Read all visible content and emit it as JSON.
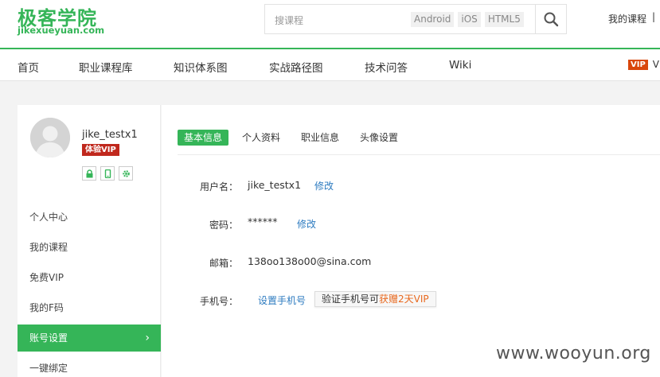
{
  "header": {
    "logo_cn": "极客学院",
    "logo_en": "jikexueyuan.com",
    "search_placeholder": "搜课程",
    "search_tags": [
      "Android",
      "iOS",
      "HTML5"
    ],
    "my_course": "我的课程",
    "separator": "|"
  },
  "nav": {
    "items": [
      "首页",
      "职业课程库",
      "知识体系图",
      "实战路径图",
      "技术问答",
      "Wiki"
    ],
    "vip_badge": "VIP",
    "vip_text": "VI"
  },
  "sidebar": {
    "username": "jike_testx1",
    "vip_label": "体验VIP",
    "bind_icons": [
      "lock-icon",
      "phone-icon",
      "gear-icon"
    ],
    "items": [
      "个人中心",
      "我的课程",
      "免费VIP",
      "我的F码",
      "账号设置",
      "一键绑定"
    ],
    "active_index": 4,
    "chevron": "›"
  },
  "content": {
    "tabs": [
      "基本信息",
      "个人资料",
      "职业信息",
      "头像设置"
    ],
    "active_tab": 0,
    "rows": {
      "username_label": "用户名：",
      "username_value": "jike_testx1",
      "username_edit": "修改",
      "password_label": "密码：",
      "password_value": "******",
      "password_edit": "修改",
      "email_label": "邮箱：",
      "email_value": "138oo138o00@sina.com",
      "phone_label": "手机号：",
      "phone_link": "设置手机号",
      "verify_text": "验证手机号可",
      "verify_highlight": "获赠2天VIP"
    }
  },
  "watermark": "www.wooyun.org",
  "colors": {
    "brand_green": "#35b558",
    "link_blue": "#2d7bc0",
    "vip_red": "#c0281d",
    "highlight_orange": "#e8681e"
  }
}
